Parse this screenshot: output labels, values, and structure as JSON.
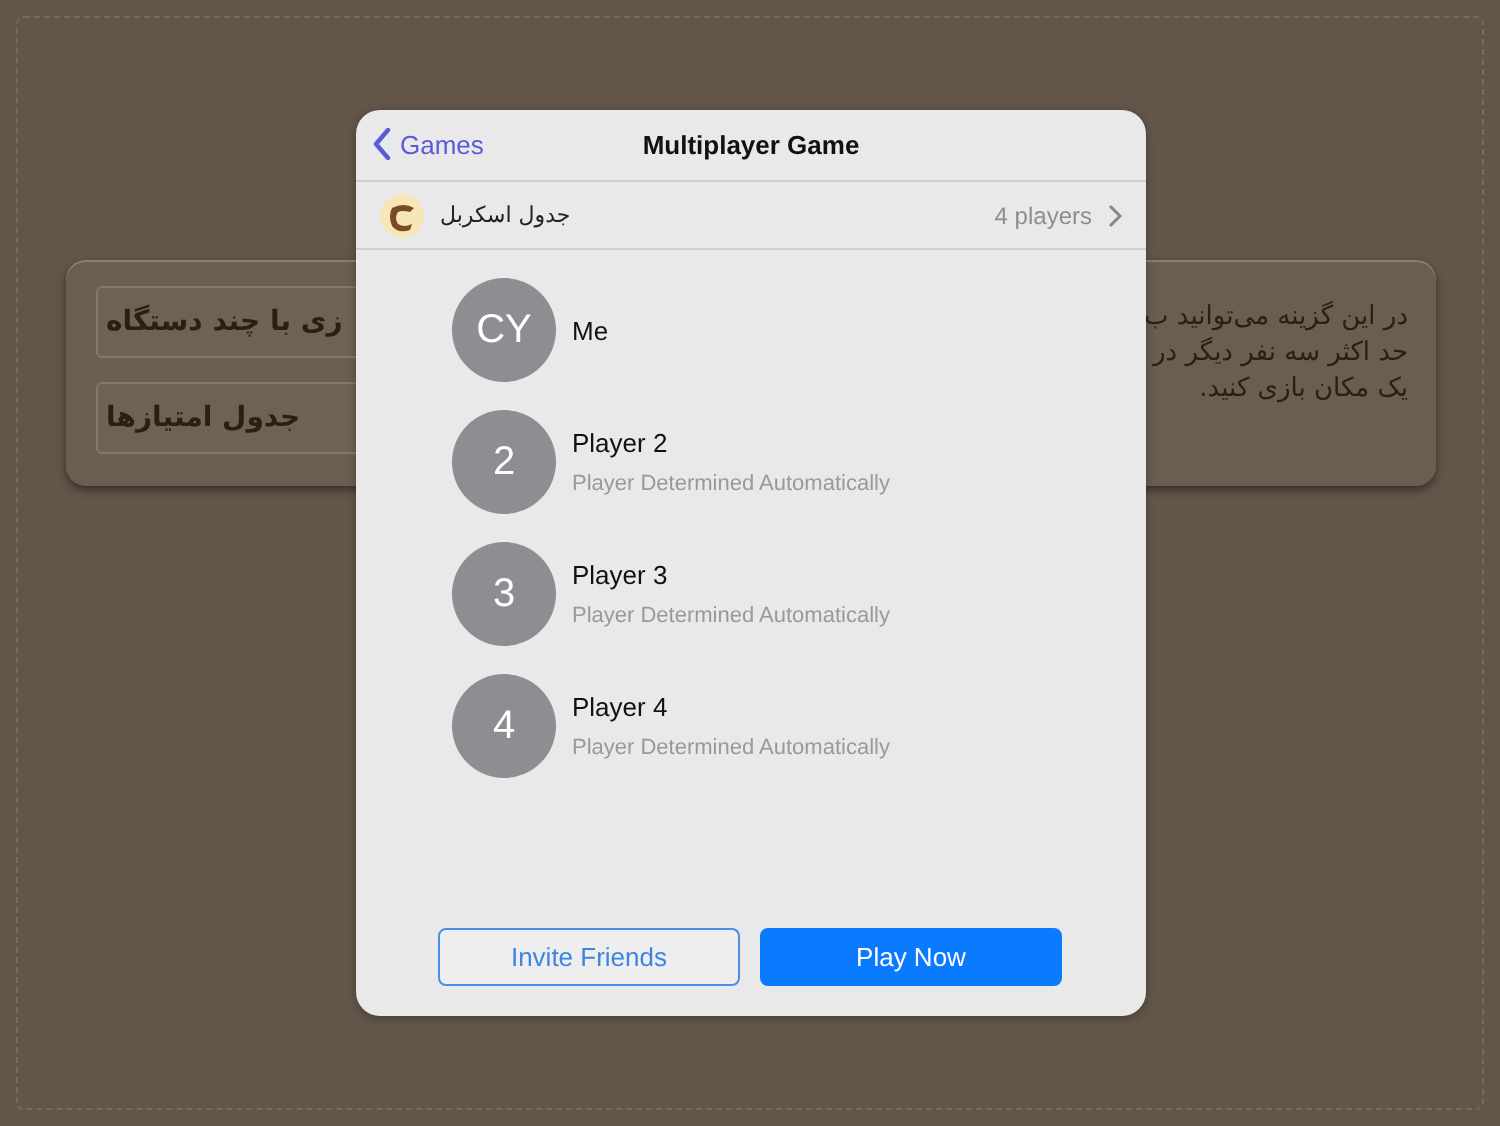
{
  "background": {
    "mode_buttons": [
      "زی با چند دستگاه",
      "جدول امتیازها"
    ],
    "description_lines": [
      "در این گزینه می‌توانید ب",
      "حد اکثر سه نفر دیگر در",
      "یک مکان بازی کنید."
    ]
  },
  "dialog": {
    "back_label": "Games",
    "title": "Multiplayer Game",
    "game": {
      "name": "جدول اسکربل",
      "count": "4 players"
    },
    "players": [
      {
        "avatar": "CY",
        "name": "Me"
      },
      {
        "avatar": "2",
        "name": "Player 2",
        "subtitle": "Player Determined Automatically"
      },
      {
        "avatar": "3",
        "name": "Player 3",
        "subtitle": "Player Determined Automatically"
      },
      {
        "avatar": "4",
        "name": "Player 4",
        "subtitle": "Player Determined Automatically"
      }
    ],
    "invite_button": "Invite Friends",
    "play_button": "Play Now"
  }
}
